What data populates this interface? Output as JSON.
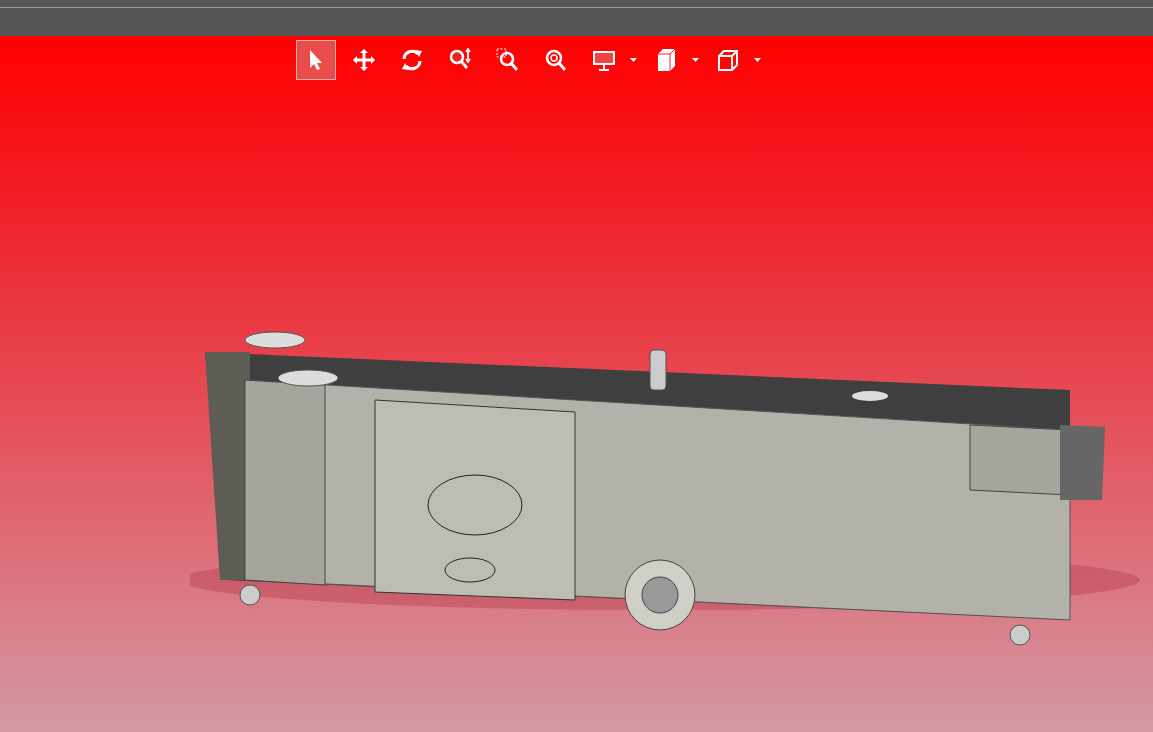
{
  "toolbar": {
    "tools": [
      {
        "kind": "select",
        "selected": true,
        "has_menu": false
      },
      {
        "kind": "pan",
        "selected": false,
        "has_menu": false
      },
      {
        "kind": "rotate",
        "selected": false,
        "has_menu": false
      },
      {
        "kind": "zoom",
        "selected": false,
        "has_menu": false
      },
      {
        "kind": "zoom-area",
        "selected": false,
        "has_menu": false
      },
      {
        "kind": "zoom-fit",
        "selected": false,
        "has_menu": false
      },
      {
        "kind": "display",
        "selected": false,
        "has_menu": true
      },
      {
        "kind": "section",
        "selected": false,
        "has_menu": true
      },
      {
        "kind": "view",
        "selected": false,
        "has_menu": true
      }
    ]
  }
}
